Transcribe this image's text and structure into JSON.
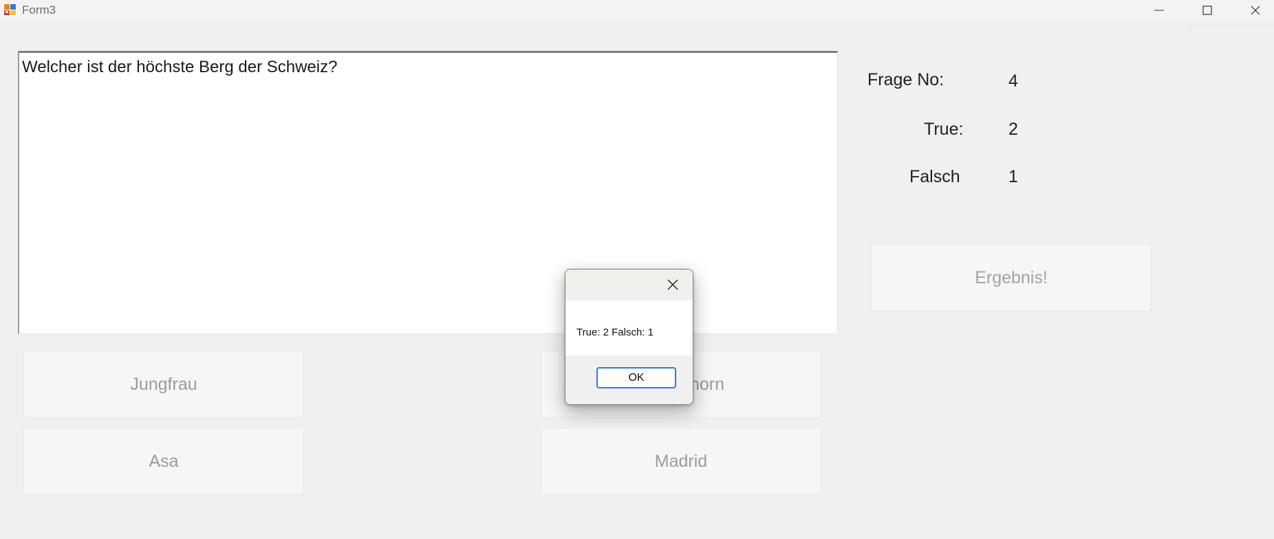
{
  "window": {
    "title": "Form3"
  },
  "question": {
    "text": "Welcher ist der höchste Berg der Schweiz?"
  },
  "stats": {
    "frage_label": "Frage No:",
    "frage_value": "4",
    "true_label": "True:",
    "true_value": "2",
    "falsch_label": "Falsch",
    "falsch_value": "1"
  },
  "buttons": {
    "result": "Ergebnis!",
    "answer_1": "Jungfrau",
    "answer_2": "horn",
    "answer_3": "Asa",
    "answer_4": "Madrid"
  },
  "messagebox": {
    "text": "True: 2 Falsch: 1",
    "ok": "OK"
  },
  "colors": {
    "background": "#f0f0f0",
    "dialog_ok_border": "#2f7bd4"
  }
}
